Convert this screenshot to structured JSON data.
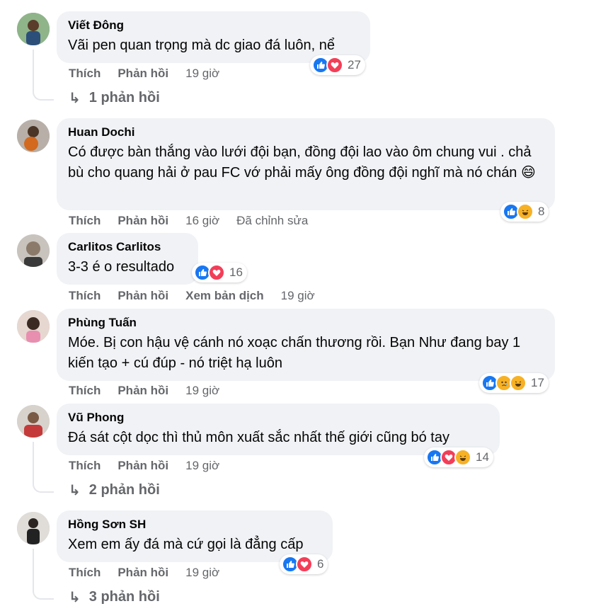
{
  "comments": [
    {
      "name": "Viết Đông",
      "text": "Vãi pen quan trọng mà dc giao đá luôn, nể",
      "actions": [
        "Thích",
        "Phản hồi"
      ],
      "time": "19 giờ",
      "edited": "",
      "translate": "",
      "reactions": [
        "like",
        "love"
      ],
      "count": "27",
      "replies": "1 phản hồi"
    },
    {
      "name": "Huan Dochi",
      "text": "Có được bàn thắng vào lưới đội bạn, đồng đội lao vào ôm chung vui . chả bù cho quang hải ở pau FC vớ phải mấy ông đồng đội nghĩ mà nó chán 😄",
      "actions": [
        "Thích",
        "Phản hồi"
      ],
      "time": "16 giờ",
      "edited": "Đã chỉnh sửa",
      "translate": "",
      "reactions": [
        "like",
        "haha"
      ],
      "count": "8",
      "replies": ""
    },
    {
      "name": "Carlitos Carlitos",
      "text": "3-3 é o resultado",
      "actions": [
        "Thích",
        "Phản hồi"
      ],
      "time": "19 giờ",
      "edited": "",
      "translate": "Xem bản dịch",
      "reactions": [
        "like",
        "love"
      ],
      "count": "16",
      "replies": ""
    },
    {
      "name": "Phùng Tuấn",
      "text": "Móe. Bị con hậu vệ cánh nó xoạc chấn thương rồi. Bạn Như đang bay 1 kiến tạo + cú đúp - nó triệt hạ luôn",
      "actions": [
        "Thích",
        "Phản hồi"
      ],
      "time": "19 giờ",
      "edited": "",
      "translate": "",
      "reactions": [
        "like",
        "sad",
        "haha"
      ],
      "count": "17",
      "replies": ""
    },
    {
      "name": "Vũ Phong",
      "text": "Đá sát cột dọc thì thủ môn xuất sắc nhất thế giới cũng bó tay",
      "actions": [
        "Thích",
        "Phản hồi"
      ],
      "time": "19 giờ",
      "edited": "",
      "translate": "",
      "reactions": [
        "like",
        "love",
        "haha"
      ],
      "count": "14",
      "replies": "2 phản hồi"
    },
    {
      "name": "Hồng Sơn SH",
      "text": "Xem em ấy đá mà cứ gọi là đẳng cấp",
      "actions": [
        "Thích",
        "Phản hồi"
      ],
      "time": "19 giờ",
      "edited": "",
      "translate": "",
      "reactions": [
        "like",
        "love"
      ],
      "count": "6",
      "replies": "3 phản hồi"
    }
  ],
  "colors": {
    "like": "#1877f2",
    "love": "#f33e58",
    "haha": "#f7b125",
    "bubble": "#f0f2f5",
    "meta": "#65676b"
  },
  "icons": {
    "like": "thumbs-up-icon",
    "love": "heart-icon",
    "haha": "laughing-face-icon",
    "sad": "crying-face-icon",
    "reply": "reply-arrow-icon"
  }
}
